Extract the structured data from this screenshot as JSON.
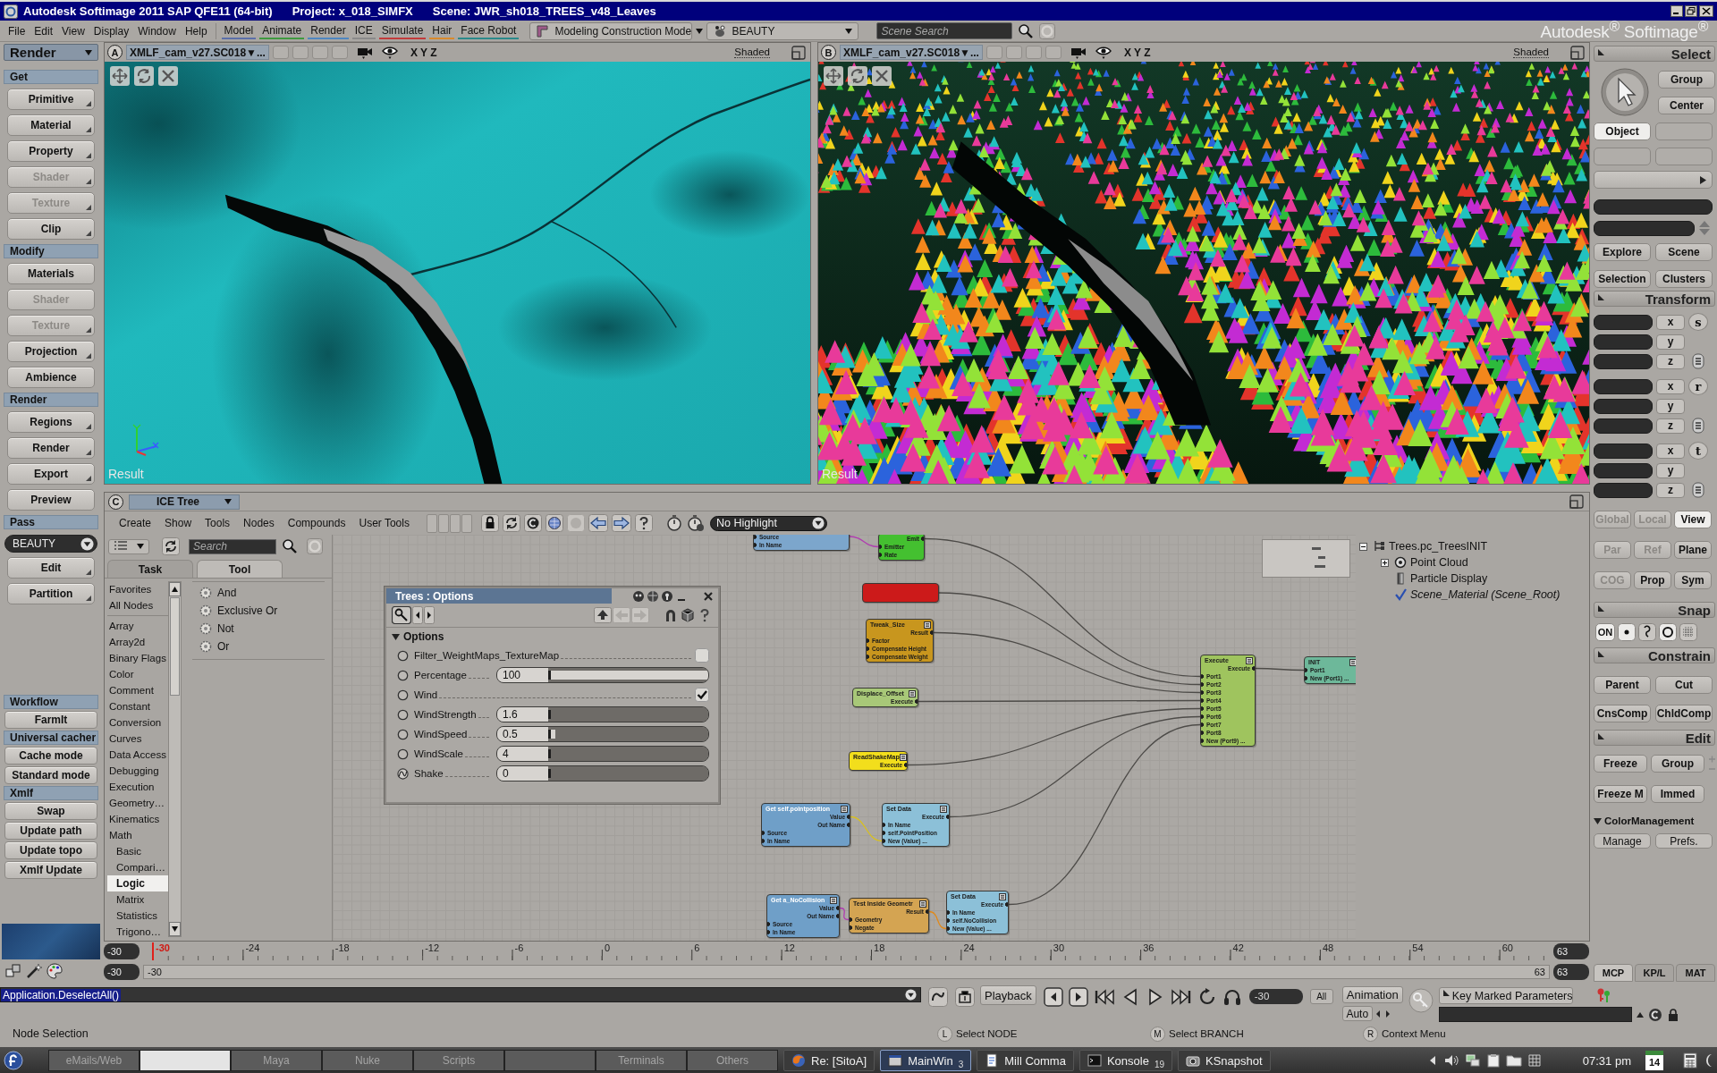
{
  "window": {
    "title": [
      "Autodesk Softimage 2011 SAP QFE11 (64-bit)",
      "Project: x_018_SIMFX",
      "Scene: JWR_sh018_TREES_v48_Leaves"
    ]
  },
  "menubar": {
    "menus": [
      "File",
      "Edit",
      "View",
      "Display",
      "Window",
      "Help"
    ],
    "modules": [
      {
        "label": "Model",
        "color": "#5b6fa8"
      },
      {
        "label": "Animate",
        "color": "#3f9a3f"
      },
      {
        "label": "Render",
        "color": "#4f86c0"
      },
      {
        "label": "ICE",
        "color": "#8a8a8a"
      },
      {
        "label": "Simulate",
        "color": "#c23b3b"
      },
      {
        "label": "Hair",
        "color": "#d98a2c"
      },
      {
        "label": "Face Robot",
        "color": "#2b8a8a"
      }
    ],
    "mode": "Modeling Construction Mode",
    "pass": "BEAUTY",
    "search": {
      "placeholder": "Scene Search"
    },
    "brand": "Autodesk$^{®}$ Softimage$^{®}$"
  },
  "left_panel": {
    "header": "Render",
    "sections": [
      {
        "title": "Get",
        "items": [
          {
            "kind": "button",
            "label": "Primitive",
            "disabled": false,
            "submenu": true
          },
          {
            "kind": "button",
            "label": "Material",
            "disabled": false,
            "submenu": true
          },
          {
            "kind": "button",
            "label": "Property",
            "disabled": false,
            "submenu": true
          },
          {
            "kind": "button",
            "label": "Shader",
            "disabled": true,
            "submenu": true
          },
          {
            "kind": "button",
            "label": "Texture",
            "disabled": true,
            "submenu": true
          },
          {
            "kind": "button",
            "label": "Clip",
            "disabled": false,
            "submenu": true
          }
        ]
      },
      {
        "title": "Modify",
        "items": [
          {
            "kind": "button",
            "label": "Materials",
            "disabled": false,
            "submenu": false
          },
          {
            "kind": "button",
            "label": "Shader",
            "disabled": true,
            "submenu": false
          },
          {
            "kind": "button",
            "label": "Texture",
            "disabled": true,
            "submenu": true
          },
          {
            "kind": "button",
            "label": "Projection",
            "disabled": false,
            "submenu": true
          },
          {
            "kind": "button",
            "label": "Ambience",
            "disabled": false,
            "submenu": false
          }
        ]
      },
      {
        "title": "Render",
        "items": [
          {
            "kind": "button",
            "label": "Regions",
            "disabled": false,
            "submenu": true
          },
          {
            "kind": "button",
            "label": "Render",
            "disabled": false,
            "submenu": true
          },
          {
            "kind": "button",
            "label": "Export",
            "disabled": false,
            "submenu": true
          },
          {
            "kind": "button",
            "label": "Preview",
            "disabled": false,
            "submenu": false
          }
        ]
      },
      {
        "title": "Pass",
        "items": [
          {
            "kind": "dropdown",
            "label": "BEAUTY",
            "disabled": false,
            "submenu": false
          },
          {
            "kind": "button",
            "label": "Edit",
            "disabled": false,
            "submenu": true
          },
          {
            "kind": "button",
            "label": "Partition",
            "disabled": false,
            "submenu": true
          }
        ]
      }
    ],
    "custom_sections": [
      {
        "title": "Workflow",
        "items": [
          {
            "kind": "button",
            "label": "FarmIt",
            "disabled": false,
            "submenu": false
          }
        ]
      },
      {
        "title": "Universal cacher",
        "items": [
          {
            "kind": "button",
            "label": "Cache mode",
            "disabled": false,
            "submenu": false
          },
          {
            "kind": "button",
            "label": "Standard mode",
            "disabled": false,
            "submenu": false
          }
        ]
      },
      {
        "title": "Xmlf",
        "items": [
          {
            "kind": "button",
            "label": "Swap",
            "disabled": false,
            "submenu": false
          },
          {
            "kind": "button",
            "label": "Update path",
            "disabled": false,
            "submenu": false
          },
          {
            "kind": "button",
            "label": "Update topo",
            "disabled": false,
            "submenu": false
          },
          {
            "kind": "button",
            "label": "Xmlf Update",
            "disabled": false,
            "submenu": false
          }
        ]
      }
    ]
  },
  "viewports": [
    {
      "letter": "A",
      "camera": "XMLF_cam_v27.SC018▼...",
      "axes": "X Y Z",
      "display": "Shaded",
      "label": "Result",
      "kind": "terrain",
      "axis_gizmo": true
    },
    {
      "letter": "B",
      "camera": "XMLF_cam_v27.SC018▼...",
      "axes": "X Y Z",
      "display": "Shaded",
      "label": "Result",
      "kind": "forest",
      "axis_gizmo": false
    }
  ],
  "ice_tree": {
    "letter": "C",
    "title": "ICE Tree",
    "menus": [
      "Create",
      "Show",
      "Tools",
      "Nodes",
      "Compounds",
      "User Tools"
    ],
    "highlight": "No Highlight",
    "search": {
      "placeholder": "Search"
    },
    "tabs": [
      {
        "label": "Task",
        "selected": false
      },
      {
        "label": "Tool",
        "selected": true
      }
    ],
    "pinned": [
      {
        "label": "Favorites",
        "selected": false
      },
      {
        "label": "All Nodes",
        "selected": false
      }
    ],
    "categories": [
      {
        "label": "Array",
        "selected": false
      },
      {
        "label": "Array2d",
        "selected": false
      },
      {
        "label": "Binary Flags",
        "selected": false
      },
      {
        "label": "Color",
        "selected": false
      },
      {
        "label": "Comment",
        "selected": false
      },
      {
        "label": "Constant",
        "selected": false
      },
      {
        "label": "Conversion",
        "selected": false
      },
      {
        "label": "Curves",
        "selected": false
      },
      {
        "label": "Data Access",
        "selected": false
      },
      {
        "label": "Debugging",
        "selected": false
      },
      {
        "label": "Execution",
        "selected": false
      },
      {
        "label": "Geometry…",
        "selected": false
      },
      {
        "label": "Kinematics",
        "selected": false
      },
      {
        "label": "Math",
        "selected": false,
        "children": [
          {
            "label": "Basic",
            "selected": false
          },
          {
            "label": "Compari…",
            "selected": false
          },
          {
            "label": "Logic",
            "selected": true
          },
          {
            "label": "Matrix",
            "selected": false
          },
          {
            "label": "Statistics",
            "selected": false
          },
          {
            "label": "Trigono…",
            "selected": false
          }
        ]
      }
    ],
    "tools": [
      "And",
      "Exclusive Or",
      "Not",
      "Or"
    ],
    "options": {
      "title": "Trees : Options",
      "section": "Options",
      "expanded": true,
      "params": [
        {
          "kind": "checkbox",
          "label": "Filter_WeightMaps_TextureMap",
          "checked": false,
          "animated": false
        },
        {
          "kind": "slider",
          "label": "Percentage",
          "value": "100",
          "level": 1,
          "animated": false
        },
        {
          "kind": "checkbox",
          "label": "Wind",
          "checked": true,
          "animated": false
        },
        {
          "kind": "slider",
          "label": "WindStrength",
          "value": "1.6",
          "level": 0,
          "animated": false
        },
        {
          "kind": "slider",
          "label": "WindSpeed",
          "value": "0.5",
          "level": 0.03,
          "animated": false
        },
        {
          "kind": "slider",
          "label": "WindScale",
          "value": "4",
          "level": 0,
          "animated": false
        },
        {
          "kind": "slider",
          "label": "Shake",
          "value": "0",
          "level": 0,
          "animated": true
        }
      ]
    },
    "nodes": [
      {
        "color": "#7ca6cc",
        "inputs": [
          "Source",
          "In Name"
        ]
      },
      {
        "color": "#44c030",
        "outputs": [
          "Emit"
        ],
        "inputs": [
          "Emitter",
          "Rate"
        ]
      },
      {
        "color": "#cc1a1a"
      },
      {
        "title": "Tweak_Size",
        "color": "#c8961e",
        "outputs": [
          "Result"
        ],
        "inputs": [
          "Factor",
          "Compensate Height",
          "Compensate Weight"
        ]
      },
      {
        "title": "Displace_Offset",
        "color": "#a8c878",
        "outputs": [
          "Execute"
        ]
      },
      {
        "title": "ReadShakeMap",
        "color": "#f2de1c",
        "outputs": [
          "Execute"
        ]
      },
      {
        "title": "Get self.pointposition",
        "color": "#6f9fc8",
        "outputs": [
          "Value",
          "Out Name"
        ],
        "inputs": [
          "Source",
          "In Name"
        ]
      },
      {
        "title": "Set Data",
        "color": "#8cc0d8",
        "outputs": [
          "Execute"
        ],
        "inputs": [
          "In Name",
          "self.PointPosition",
          "New (Value) ..."
        ]
      },
      {
        "title": "Get a_NoCollision",
        "color": "#6f9fc8",
        "outputs": [
          "Value",
          "Out Name"
        ],
        "inputs": [
          "Source",
          "In Name"
        ]
      },
      {
        "title": "Test Inside Geometr",
        "color": "#d4a452",
        "outputs": [
          "Result"
        ],
        "inputs": [
          "Geometry",
          "Negate"
        ]
      },
      {
        "title": "Set Data",
        "color": "#8cc0d8",
        "outputs": [
          "Execute"
        ],
        "inputs": [
          "In Name",
          "self.NoCollision",
          "New (Value) ..."
        ]
      },
      {
        "title": "Execute",
        "color": "#9fc45e",
        "outputs": [
          "Execute"
        ],
        "inputs": [
          "Port1",
          "Port2",
          "Port3",
          "Port4",
          "Port5",
          "Port6",
          "Port7",
          "Port8",
          "New (Port9) ..."
        ]
      },
      {
        "title": "INIT",
        "color": "#6db89a",
        "inputs": [
          "Port1",
          "New (Port1) ..."
        ]
      }
    ],
    "outliner": [
      {
        "label": "Trees.pc_TreesINIT",
        "kind": "model",
        "expanded": true,
        "children": [
          {
            "label": "Point Cloud",
            "kind": "pointcloud",
            "expanded": false
          },
          {
            "label": "Particle Display",
            "kind": "property"
          },
          {
            "label": "Scene_Material (Scene_Root)",
            "kind": "material"
          }
        ]
      }
    ]
  },
  "timeline": {
    "start_field": "-30",
    "end_field": "63",
    "current_frame": "-30",
    "ticks": [
      "-24",
      "-18",
      "-12",
      "-6",
      "0",
      "6",
      "12",
      "18",
      "24",
      "30",
      "36",
      "42",
      "48",
      "54",
      "60"
    ],
    "range_start_field": "-30",
    "range_start": "-30",
    "range_end": "63",
    "range_end_field": "63"
  },
  "mcp": {
    "select": {
      "title": "Select",
      "tools": [
        {
          "label": "Group",
          "selected": false
        },
        {
          "label": "Center",
          "selected": false
        }
      ],
      "filters": [
        {
          "label": "Object",
          "selected": true
        }
      ],
      "explorers": [
        "Explore",
        "Scene",
        "Selection",
        "Clusters"
      ]
    },
    "transform": {
      "title": "Transform",
      "groups": [
        {
          "tool": "s",
          "axes": [
            "x",
            "y",
            "z"
          ]
        },
        {
          "tool": "r",
          "axes": [
            "x",
            "y",
            "z"
          ]
        },
        {
          "tool": "t",
          "axes": [
            "x",
            "y",
            "z"
          ]
        }
      ],
      "modes": [
        {
          "label": "Global",
          "disabled": true,
          "selected": false
        },
        {
          "label": "Local",
          "disabled": true,
          "selected": false
        },
        {
          "label": "View",
          "disabled": false,
          "selected": true
        },
        {
          "label": "Par",
          "disabled": true,
          "selected": false
        },
        {
          "label": "Ref",
          "disabled": true,
          "selected": false
        },
        {
          "label": "Plane",
          "disabled": false,
          "selected": false
        },
        {
          "label": "COG",
          "disabled": true,
          "selected": false
        },
        {
          "label": "Prop",
          "disabled": false,
          "selected": false
        },
        {
          "label": "Sym",
          "disabled": false,
          "selected": false
        }
      ]
    },
    "snap": {
      "title": "Snap",
      "toggle": "ON"
    },
    "constrain": {
      "title": "Constrain",
      "buttons": [
        "Parent",
        "Cut",
        "CnsComp",
        "ChldComp"
      ]
    },
    "edit": {
      "title": "Edit",
      "buttons": [
        "Freeze",
        "Group",
        "Freeze M",
        "Immed"
      ]
    },
    "color_management": {
      "title": "ColorManagement",
      "expanded": true,
      "buttons": [
        "Manage",
        "Prefs."
      ]
    },
    "tabs": [
      {
        "label": "MCP",
        "selected": true
      },
      {
        "label": "KP/L",
        "selected": false
      },
      {
        "label": "MAT",
        "selected": false
      }
    ]
  },
  "command_bar": {
    "command": "Application.DeselectAll()",
    "playback": "Playback",
    "frame": "-30",
    "all": "All",
    "animation": "Animation",
    "auto": "Auto",
    "keying": "Key Marked Parameters"
  },
  "status_bar": {
    "message": "Node Selection",
    "mouse": [
      {
        "key": "L",
        "action": "Select NODE"
      },
      {
        "key": "M",
        "action": "Select BRANCH"
      },
      {
        "key": "R",
        "action": "Context Menu"
      }
    ]
  },
  "taskbar": {
    "desktops": [
      {
        "label": "eMails/Web",
        "selected": false
      },
      {
        "selected": true
      },
      {
        "label": "Maya",
        "selected": false
      },
      {
        "label": "Nuke",
        "selected": false
      },
      {
        "label": "Scripts",
        "selected": false
      },
      {
        "selected": false
      },
      {
        "label": "Terminals",
        "selected": false
      },
      {
        "label": "Others",
        "selected": false
      }
    ],
    "tasks": [
      {
        "kind": "browser",
        "label": "Re: [SitoA]",
        "active": false
      },
      {
        "kind": "app",
        "label": "MainWin",
        "count": "3",
        "active": true
      },
      {
        "kind": "files",
        "label": "Mill Comma",
        "active": false
      },
      {
        "kind": "terminal",
        "label": "Konsole",
        "count": "19",
        "active": false
      },
      {
        "kind": "camera",
        "label": "KSnapshot",
        "active": false
      }
    ],
    "clock": "07:31 pm",
    "date": "14"
  }
}
